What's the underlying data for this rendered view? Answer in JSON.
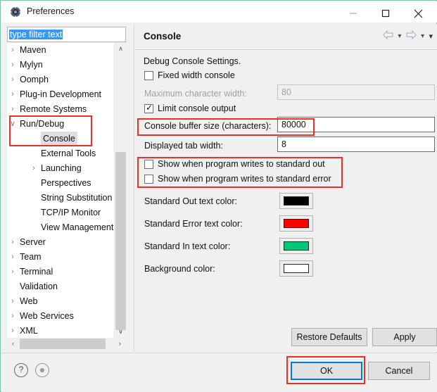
{
  "window": {
    "title": "Preferences",
    "icon": "preferences-gear-icon",
    "minimize_label": "—",
    "maximize_label": "□",
    "close_label": "✕"
  },
  "filter": {
    "value": "type filter text",
    "placeholder": "type filter text"
  },
  "tree": {
    "items": [
      {
        "label": "Maven",
        "twisty": "›",
        "indent": 18,
        "selected": false
      },
      {
        "label": "Mylyn",
        "twisty": "›",
        "indent": 18,
        "selected": false
      },
      {
        "label": "Oomph",
        "twisty": "›",
        "indent": 18,
        "selected": false
      },
      {
        "label": "Plug-in Development",
        "twisty": "›",
        "indent": 18,
        "selected": false
      },
      {
        "label": "Remote Systems",
        "twisty": "›",
        "indent": 18,
        "selected": false
      },
      {
        "label": "Run/Debug",
        "twisty": "∨",
        "indent": 18,
        "selected": false
      },
      {
        "label": "Console",
        "twisty": "",
        "indent": 48,
        "selected": true
      },
      {
        "label": "External Tools",
        "twisty": "",
        "indent": 48,
        "selected": false
      },
      {
        "label": "Launching",
        "twisty": "›",
        "indent": 48,
        "selected": false
      },
      {
        "label": "Perspectives",
        "twisty": "",
        "indent": 48,
        "selected": false
      },
      {
        "label": "String Substitution",
        "twisty": "",
        "indent": 48,
        "selected": false
      },
      {
        "label": "TCP/IP Monitor",
        "twisty": "",
        "indent": 48,
        "selected": false
      },
      {
        "label": "View Management",
        "twisty": "",
        "indent": 48,
        "selected": false
      },
      {
        "label": "Server",
        "twisty": "›",
        "indent": 18,
        "selected": false
      },
      {
        "label": "Team",
        "twisty": "›",
        "indent": 18,
        "selected": false
      },
      {
        "label": "Terminal",
        "twisty": "›",
        "indent": 18,
        "selected": false
      },
      {
        "label": "Validation",
        "twisty": "",
        "indent": 18,
        "selected": false
      },
      {
        "label": "Web",
        "twisty": "›",
        "indent": 18,
        "selected": false
      },
      {
        "label": "Web Services",
        "twisty": "›",
        "indent": 18,
        "selected": false
      },
      {
        "label": "XML",
        "twisty": "›",
        "indent": 18,
        "selected": false
      }
    ],
    "vscroll_up": "∧",
    "vscroll_down": "∨",
    "hscroll_left": "‹",
    "hscroll_right": "›"
  },
  "content": {
    "title": "Console",
    "group_label": "Debug Console Settings.",
    "nav": {
      "back": "back-arrow-icon",
      "back_menu": "▾",
      "forward": "forward-arrow-icon",
      "forward_menu": "▾",
      "view_menu": "▾"
    },
    "fixed_width_console": {
      "label": "Fixed width console",
      "checked": false
    },
    "max_char_width": {
      "label": "Maximum character width:",
      "value": "80",
      "disabled": true
    },
    "limit_console_output": {
      "label": "Limit console output",
      "checked": true
    },
    "console_buffer_size": {
      "label": "Console buffer size (characters):",
      "value": "80000"
    },
    "displayed_tab_width": {
      "label": "Displayed tab width:",
      "value": "8"
    },
    "show_stdout": {
      "label": "Show when program writes to standard out",
      "checked": false
    },
    "show_stderr": {
      "label": "Show when program writes to standard error",
      "checked": false
    },
    "colors": [
      {
        "label": "Standard Out text color:",
        "value": "#000000"
      },
      {
        "label": "Standard Error text color:",
        "value": "#FF0000"
      },
      {
        "label": "Standard In text color:",
        "value": "#00C878"
      },
      {
        "label": "Background color:",
        "value": "#FFFFFF"
      }
    ],
    "restore_defaults": "Restore Defaults",
    "apply": "Apply"
  },
  "footer": {
    "help": "?",
    "secondary": "●",
    "ok": "OK",
    "cancel": "Cancel"
  },
  "annotations": {
    "accent_color": "#E8312A",
    "focus_color": "#0078D7"
  }
}
